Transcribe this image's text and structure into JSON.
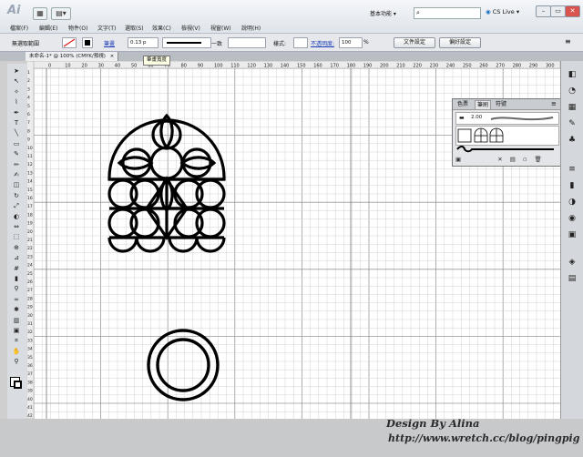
{
  "app": {
    "logo": "Ai",
    "workspace": "基本功能",
    "search_placeholder": "",
    "cs_live": "CS Live",
    "menu": [
      "檔案(F)",
      "編輯(E)",
      "物件(O)",
      "文字(T)",
      "選取(S)",
      "效果(C)",
      "檢視(V)",
      "視窗(W)",
      "說明(H)"
    ]
  },
  "controlbar": {
    "selection_label": "無選取範圍",
    "stroke_label": "筆畫",
    "stroke_value": "0.13 p",
    "uniform_label": "一致",
    "style_label": "樣式:",
    "opacity_label": "不透明度:",
    "opacity_value": "100",
    "percent": "%",
    "doc_setup": "文件設定",
    "preferences": "偏好設定"
  },
  "document": {
    "tab_title": "未命名-1* @ 100% (CMYK/預視)",
    "tooltip": "筆畫寬度"
  },
  "panel": {
    "tabs": [
      "色票",
      "筆刷",
      "符號"
    ],
    "active_tab": "筆刷",
    "brush_size": "2.00"
  },
  "rulers": {
    "top": [
      "0",
      "10",
      "20",
      "30",
      "40",
      "50",
      "60",
      "70",
      "80",
      "90",
      "100",
      "110",
      "120",
      "130",
      "140",
      "150",
      "160",
      "170",
      "180",
      "190",
      "200",
      "210",
      "220",
      "230",
      "240",
      "250",
      "260",
      "270",
      "280",
      "290",
      "300",
      "310",
      "320"
    ],
    "left": [
      "1",
      "2",
      "3",
      "4",
      "5",
      "6",
      "7",
      "8",
      "9",
      "10",
      "11",
      "12",
      "13",
      "14",
      "15",
      "16",
      "17",
      "18",
      "19",
      "20",
      "21",
      "22",
      "23",
      "24",
      "25",
      "26",
      "27",
      "28",
      "29",
      "30",
      "31",
      "32",
      "33",
      "34",
      "35",
      "36",
      "37",
      "38",
      "39",
      "40",
      "41",
      "42",
      "43"
    ]
  },
  "tools": [
    "selection",
    "direct-selection",
    "magic-wand",
    "lasso",
    "pen",
    "type",
    "line",
    "rectangle",
    "paintbrush",
    "pencil",
    "blob-brush",
    "eraser",
    "rotate",
    "scale",
    "warp",
    "width",
    "free-transform",
    "shape-builder",
    "perspective",
    "mesh",
    "gradient",
    "eyedropper",
    "blend",
    "symbol-sprayer",
    "column-graph",
    "artboard",
    "slice",
    "hand",
    "zoom"
  ],
  "dock_icons": [
    "color-icon",
    "color-guide-icon",
    "swatches-icon",
    "brushes-icon",
    "symbols-icon",
    "stroke-icon",
    "gradient-icon",
    "transparency-icon",
    "appearance-icon",
    "graphic-styles-icon",
    "layers-icon",
    "artboards-icon"
  ],
  "credit": {
    "line1": "Design By Alina",
    "line2": "http://www.wretch.cc/blog/pingpig"
  }
}
